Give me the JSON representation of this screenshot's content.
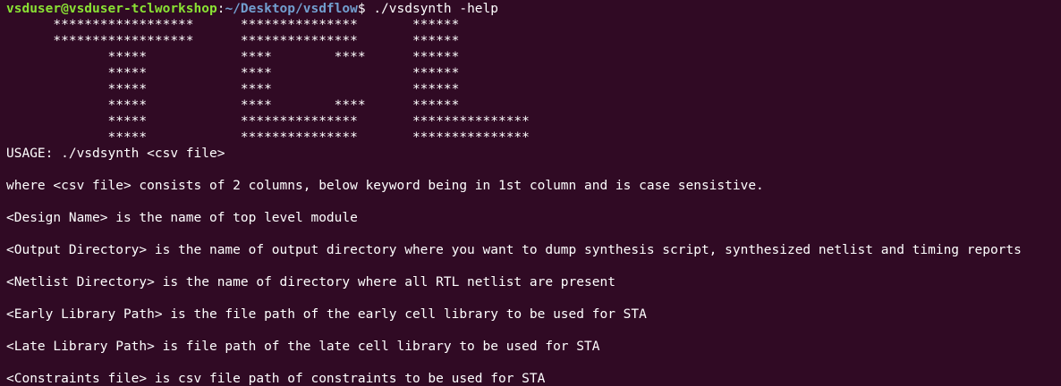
{
  "prompt": {
    "user_host": "vsduser@vsduser-tclworkshop",
    "separator": ":",
    "path": "~/Desktop/vsdflow",
    "symbol": "$ ",
    "command": "./vsdsynth -help"
  },
  "banner": [
    "      ******************      ***************       ******",
    "      ******************      ***************       ******",
    "             *****            ****        ****      ******",
    "             *****            ****                  ******",
    "             *****            ****                  ******",
    "             *****            ****        ****      ******",
    "             *****            ***************       ***************",
    "             *****            ***************       ***************"
  ],
  "output": [
    "USAGE: ./vsdsynth <csv file>",
    "",
    "where <csv file> consists of 2 columns, below keyword being in 1st column and is case sensistive.",
    "",
    "<Design Name> is the name of top level module",
    "",
    "<Output Directory> is the name of output directory where you want to dump synthesis script, synthesized netlist and timing reports",
    "",
    "<Netlist Directory> is the name of directory where all RTL netlist are present",
    "",
    "<Early Library Path> is the file path of the early cell library to be used for STA",
    "",
    "<Late Library Path> is file path of the late cell library to be used for STA",
    "",
    "<Constraints file> is csv file path of constraints to be used for STA"
  ],
  "colors": {
    "background": "#300a24",
    "text": "#ffffff",
    "prompt_user": "#8ae234",
    "prompt_path": "#729fcf"
  }
}
